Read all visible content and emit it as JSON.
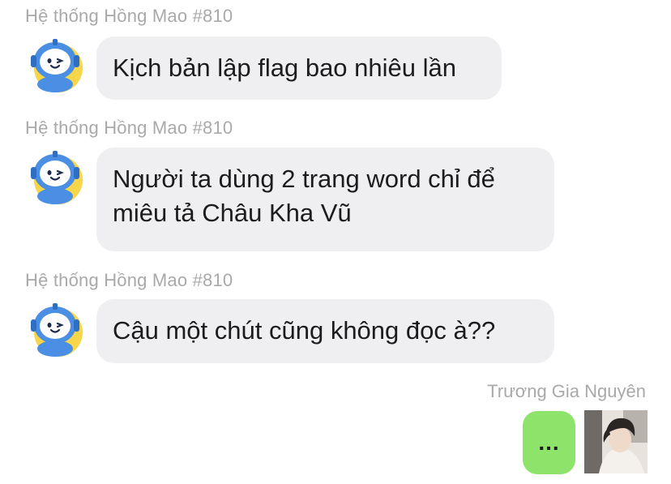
{
  "messages": [
    {
      "sender": "Hệ thống Hồng Mao #810",
      "lines": [
        "Kịch bản lập flag bao nhiêu lần"
      ]
    },
    {
      "sender": "Hệ thống Hồng Mao #810",
      "lines": [
        "Người ta dùng 2 trang word chỉ để",
        "miêu tả Châu Kha Vũ"
      ]
    },
    {
      "sender": "Hệ thống Hồng Mao #810",
      "lines": [
        "Cậu một chút cũng không đọc à??"
      ]
    }
  ],
  "self": {
    "name": "Trương Gia Nguyên",
    "message": "..."
  },
  "colors": {
    "incoming_bubble": "#efeff1",
    "outgoing_bubble": "#8ee36a",
    "name_text": "#a9a9a9",
    "avatar_robot": "#4a8fe3",
    "avatar_bg": "#f7d64a"
  }
}
